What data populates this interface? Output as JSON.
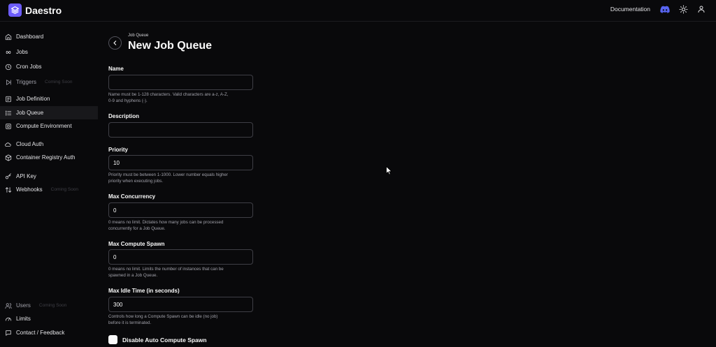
{
  "app": {
    "name": "Daestro"
  },
  "header": {
    "documentation_label": "Documentation"
  },
  "sidebar": {
    "items": [
      {
        "label": "Dashboard",
        "icon": "home-icon"
      },
      {
        "label": "Jobs",
        "icon": "jobs-icon"
      },
      {
        "label": "Cron Jobs",
        "icon": "clock-icon"
      },
      {
        "label": "Triggers",
        "badge": "Coming Soon",
        "icon": "trigger-icon"
      },
      {
        "label": "Job Definition",
        "icon": "file-icon"
      },
      {
        "label": "Job Queue",
        "icon": "list-icon",
        "active": true
      },
      {
        "label": "Compute Environment",
        "icon": "cpu-icon"
      },
      {
        "label": "Cloud Auth",
        "icon": "cloud-icon"
      },
      {
        "label": "Container Registry Auth",
        "icon": "box-icon"
      },
      {
        "label": "API Key",
        "icon": "key-icon"
      },
      {
        "label": "Webhooks",
        "badge": "Coming Soon",
        "icon": "webhook-icon"
      }
    ],
    "bottom_items": [
      {
        "label": "Users",
        "badge": "Coming Soon",
        "icon": "users-icon"
      },
      {
        "label": "Limits",
        "icon": "gauge-icon"
      },
      {
        "label": "Contact / Feedback",
        "icon": "message-icon"
      }
    ]
  },
  "page": {
    "breadcrumb": "Job Queue",
    "title": "New Job Queue"
  },
  "form": {
    "name": {
      "label": "Name",
      "value": "",
      "help": "Name must be 1-128 characters. Valid characters are a-z, A-Z, 0-9 and hyphens (-)."
    },
    "description": {
      "label": "Description",
      "value": ""
    },
    "priority": {
      "label": "Priority",
      "value": "10",
      "help": "Priority must be between 1-1000. Lower number equals higher priority when executing jobs."
    },
    "max_concurrency": {
      "label": "Max Concurrency",
      "value": "0",
      "help": "0 means no limit. Dictates how many jobs can be processed concurrently for a Job Queue."
    },
    "max_compute_spawn": {
      "label": "Max Compute Spawn",
      "value": "0",
      "help": "0 means no limit. Limits the number of instances that can be spawned in a Job Queue."
    },
    "max_idle_time": {
      "label": "Max Idle Time (in seconds)",
      "value": "300",
      "help": "Controls how long a Compute Spawn can be idle (no job) before it is terminated."
    },
    "disable_auto_spawn": {
      "label": "Disable Auto Compute Spawn",
      "checked": false
    }
  },
  "colors": {
    "background": "#09090b",
    "brand": "#6d5dfc",
    "discord": "#5865f2",
    "muted_text": "#a1a1aa"
  }
}
